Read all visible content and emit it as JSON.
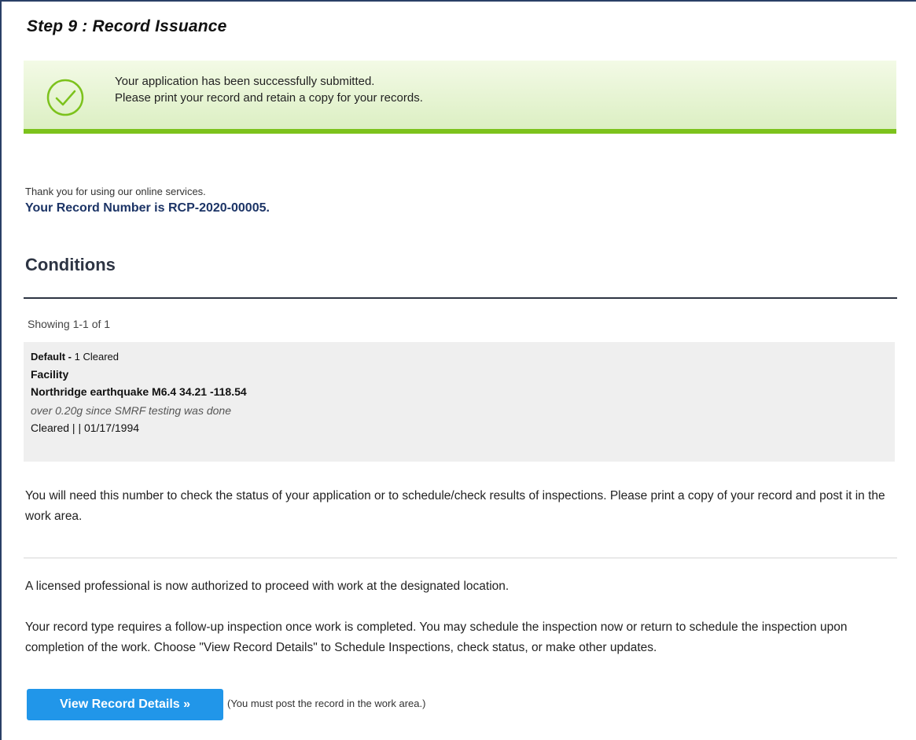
{
  "step": {
    "title": "Step 9 : Record Issuance"
  },
  "success": {
    "icon": "check-circle-icon",
    "line1": "Your application has been successfully submitted.",
    "line2": "Please print your record and retain a copy for your records.",
    "accent_color": "#7cc21c"
  },
  "thank_you": "Thank you for using our online services.",
  "record_number_text": "Your Record Number is RCP-2020-00005.",
  "conditions": {
    "heading": "Conditions",
    "showing": "Showing 1-1 of 1",
    "item": {
      "default_label": "Default - ",
      "default_status": "1 Cleared",
      "group": "Facility",
      "name": "Northridge earthquake M6.4 34.21 -118.54",
      "description": "over 0.20g since SMRF testing was done",
      "status_line": "Cleared | | 01/17/1994"
    }
  },
  "notice_text": "You will need this number to check the status of your application or to schedule/check results of inspections. Please print a copy of your record and post it in the work area.",
  "authorized_text": "A licensed professional is now authorized to proceed with work at the designated location.",
  "followup_text": "Your record type requires a follow-up inspection once work is completed. You may schedule the inspection now or return to schedule the inspection upon completion of the work. Choose \"View Record Details\" to Schedule Inspections, check status, or make other updates.",
  "actions": {
    "view_button_label": "View Record Details »",
    "button_color": "#2196e9",
    "note": "(You must post the record in the work area.)"
  }
}
